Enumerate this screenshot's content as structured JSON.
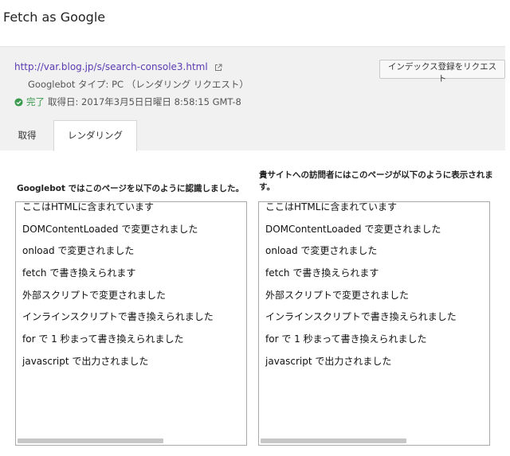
{
  "page": {
    "title": "Fetch as Google"
  },
  "fetch": {
    "url": "http://var.blog.jp/s/search-console3.html",
    "bot_line": "Googlebot タイプ: PC （レンダリング リクエスト）",
    "status": "完了",
    "fetched_at": "取得日: 2017年3月5日日曜日 8:58:15 GMT-8",
    "request_button": "インデックス登録をリクエスト"
  },
  "tabs": [
    {
      "label": "取得",
      "active": false
    },
    {
      "label": "レンダリング",
      "active": true
    }
  ],
  "googlebot_view": {
    "caption": "Googlebot ではこのページを以下のように認識しました。",
    "lines": [
      "ここはHTMLに含まれています",
      "DOMContentLoaded で変更されました",
      "onload で変更されました",
      "fetch で書き換えられます",
      "外部スクリプトで変更されました",
      "インラインスクリプトで書き換えられました",
      "for で 1 秒まって書き換えられました",
      "javascript で出力されました"
    ]
  },
  "visitor_view": {
    "caption": "貴サイトへの訪問者にはこのページが以下のように表示されます。",
    "lines": [
      "ここはHTMLに含まれています",
      "DOMContentLoaded で変更されました",
      "onload で変更されました",
      "fetch で書き換えられます",
      "外部スクリプトで変更されました",
      "インラインスクリプトで書き換えられました",
      "for で 1 秒まって書き換えられました",
      "javascript で出力されました"
    ]
  },
  "colors": {
    "link": "#5b3bb2",
    "status_ok": "#3a9a4e",
    "panel_bg": "#f1f1f1"
  },
  "icons": {
    "external_link": "external-link-icon",
    "status": "check-circle-icon"
  }
}
